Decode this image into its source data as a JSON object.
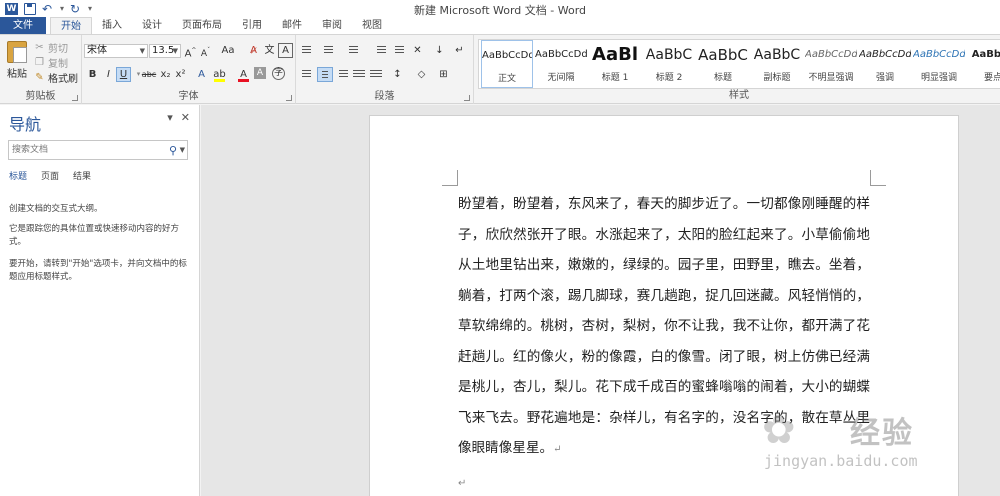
{
  "window": {
    "title": "新建 Microsoft Word 文档 - Word"
  },
  "ribbon_tabs": [
    {
      "label": "文件",
      "kind": "file"
    },
    {
      "label": "开始",
      "kind": "active"
    },
    {
      "label": "插入",
      "kind": ""
    },
    {
      "label": "设计",
      "kind": ""
    },
    {
      "label": "页面布局",
      "kind": ""
    },
    {
      "label": "引用",
      "kind": ""
    },
    {
      "label": "邮件",
      "kind": ""
    },
    {
      "label": "审阅",
      "kind": ""
    },
    {
      "label": "视图",
      "kind": ""
    }
  ],
  "clipboard": {
    "group_label": "剪贴板",
    "paste": "粘贴",
    "cut": "剪切",
    "copy": "复制",
    "format_painter": "格式刷"
  },
  "font": {
    "group_label": "字体",
    "font_name": "宋体",
    "font_size": "13.5",
    "grow": "A",
    "shrink": "A",
    "change_case": "Aa",
    "bold": "B",
    "italic": "I",
    "underline": "U",
    "strikethrough": "abc",
    "subscript": "x₂",
    "superscript": "x²",
    "highlight_color": "#ffff00",
    "font_color": "#e81123"
  },
  "paragraph": {
    "group_label": "段落"
  },
  "styles": {
    "group_label": "样式",
    "items": [
      {
        "sample": "AaBbCcDd",
        "name": "正文",
        "weight": "normal",
        "size": "10px",
        "italic": false,
        "color": "#222"
      },
      {
        "sample": "AaBbCcDd",
        "name": "无间隔",
        "weight": "normal",
        "size": "10px",
        "italic": false,
        "color": "#222"
      },
      {
        "sample": "AaBl",
        "name": "标题 1",
        "weight": "bold",
        "size": "18px",
        "italic": false,
        "color": "#111"
      },
      {
        "sample": "AaBbC",
        "name": "标题 2",
        "weight": "normal",
        "size": "14px",
        "italic": false,
        "color": "#222"
      },
      {
        "sample": "AaBbC",
        "name": "标题",
        "weight": "normal",
        "size": "15px",
        "italic": false,
        "color": "#222"
      },
      {
        "sample": "AaBbC",
        "name": "副标题",
        "weight": "normal",
        "size": "14px",
        "italic": false,
        "color": "#222"
      },
      {
        "sample": "AaBbCcDd",
        "name": "不明显强调",
        "weight": "normal",
        "size": "10px",
        "italic": true,
        "color": "#666"
      },
      {
        "sample": "AaBbCcDd",
        "name": "强调",
        "weight": "normal",
        "size": "10px",
        "italic": true,
        "color": "#222"
      },
      {
        "sample": "AaBbCcDd",
        "name": "明显强调",
        "weight": "normal",
        "size": "10px",
        "italic": true,
        "color": "#2e74b5"
      },
      {
        "sample": "AaBbCc",
        "name": "要点",
        "weight": "bold",
        "size": "10px",
        "italic": false,
        "color": "#222"
      }
    ]
  },
  "nav_pane": {
    "title": "导航",
    "search_placeholder": "搜索文档",
    "tabs": [
      "标题",
      "页面",
      "结果"
    ],
    "hint1": "创建文档的交互式大纲。",
    "hint2": "它是跟踪您的具体位置或快速移动内容的好方式。",
    "hint3": "要开始，请转到\"开始\"选项卡，并向文档中的标题应用标题样式。"
  },
  "document": {
    "body": "盼望着，盼望着，东风来了，春天的脚步近了。一切都像刚睡醒的样子，欣欣然张开了眼。水涨起来了，太阳的脸红起来了。小草偷偷地从土地里钻出来，嫩嫩的，绿绿的。园子里，田野里，瞧去。坐着，躺着，打两个滚，踢几脚球，赛几趟跑，捉几回迷藏。风轻悄悄的，草软绵绵的。桃树，杏树，梨树，你不让我，我不让你，都开满了花赶趟儿。红的像火，粉的像霞，白的像雪。闭了眼，树上仿佛已经满是桃儿，杏儿，梨儿。花下成千成百的蜜蜂嗡嗡的闹着，大小的蝴蝶飞来飞去。野花遍地是：杂样儿，有名字的，没名字的，散在草丛里像眼睛像星星。",
    "para_mark": "↵"
  },
  "watermark": {
    "brand": "经验",
    "url": "jingyan.baidu.com"
  }
}
